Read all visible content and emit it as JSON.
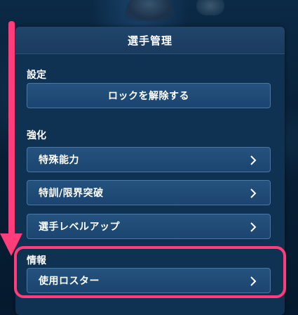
{
  "panel": {
    "title": "選手管理"
  },
  "settings": {
    "section_label": "設定",
    "unlock_button": "ロックを解除する"
  },
  "enhance": {
    "section_label": "強化",
    "items": [
      {
        "label": "特殊能力"
      },
      {
        "label": "特訓/限界突破"
      },
      {
        "label": "選手レベルアップ"
      }
    ]
  },
  "info": {
    "section_label": "情報",
    "items": [
      {
        "label": "使用ロスター"
      }
    ]
  },
  "colors": {
    "annotation": "#ff3d7a",
    "panel_bg": "#0f3152",
    "button_bg": "#1f4a75",
    "button_border": "#4878a4"
  },
  "icons": {
    "chevron": "chevron-right-icon"
  }
}
